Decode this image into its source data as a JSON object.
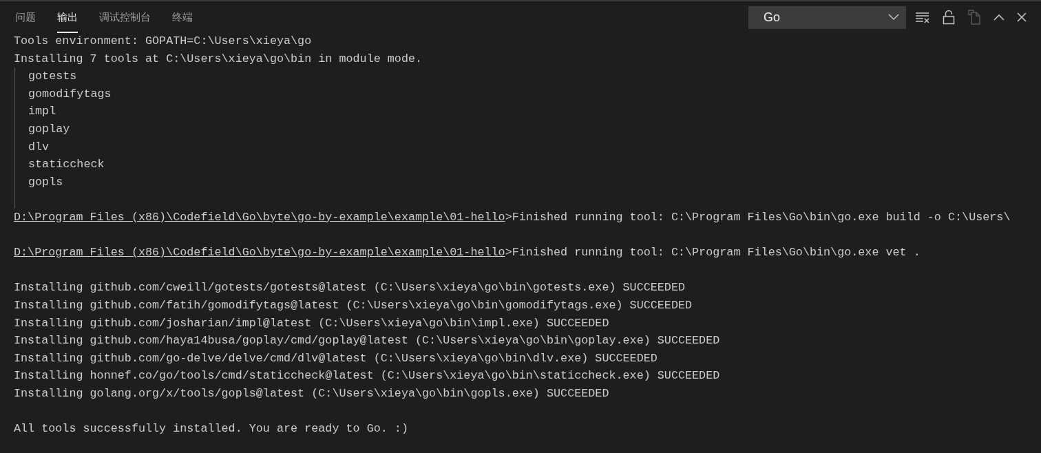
{
  "tabs": [
    {
      "label": "问题",
      "selected": false
    },
    {
      "label": "输出",
      "selected": true
    },
    {
      "label": "调试控制台",
      "selected": false
    },
    {
      "label": "终端",
      "selected": false
    }
  ],
  "channel_select": {
    "value": "Go"
  },
  "actions": [
    {
      "kind": "clear",
      "disabled": false
    },
    {
      "kind": "lock",
      "disabled": false
    },
    {
      "kind": "copy",
      "disabled": true
    },
    {
      "kind": "maximize",
      "disabled": false
    },
    {
      "kind": "close",
      "disabled": false
    }
  ],
  "output_lines": [
    {
      "kind": "text",
      "text": "Tools environment: GOPATH=C:\\Users\\xieya\\go"
    },
    {
      "kind": "text",
      "text": "Installing 7 tools at C:\\Users\\xieya\\go\\bin in module mode."
    },
    {
      "kind": "group",
      "items": [
        "gotests",
        "gomodifytags",
        "impl",
        "goplay",
        "dlv",
        "staticcheck",
        "gopls"
      ]
    },
    {
      "kind": "link",
      "link": "D:\\Program Files (x86)\\Codefield\\Go\\byte\\go-by-example\\example\\01-hello",
      "text": ">Finished running tool: C:\\Program Files\\Go\\bin\\go.exe build -o C:\\Users\\"
    },
    {
      "kind": "blank"
    },
    {
      "kind": "link",
      "link": "D:\\Program Files (x86)\\Codefield\\Go\\byte\\go-by-example\\example\\01-hello",
      "text": ">Finished running tool: C:\\Program Files\\Go\\bin\\go.exe vet ."
    },
    {
      "kind": "blank"
    },
    {
      "kind": "text",
      "text": "Installing github.com/cweill/gotests/gotests@latest (C:\\Users\\xieya\\go\\bin\\gotests.exe) SUCCEEDED"
    },
    {
      "kind": "text",
      "text": "Installing github.com/fatih/gomodifytags@latest (C:\\Users\\xieya\\go\\bin\\gomodifytags.exe) SUCCEEDED"
    },
    {
      "kind": "text",
      "text": "Installing github.com/josharian/impl@latest (C:\\Users\\xieya\\go\\bin\\impl.exe) SUCCEEDED"
    },
    {
      "kind": "text",
      "text": "Installing github.com/haya14busa/goplay/cmd/goplay@latest (C:\\Users\\xieya\\go\\bin\\goplay.exe) SUCCEEDED"
    },
    {
      "kind": "text",
      "text": "Installing github.com/go-delve/delve/cmd/dlv@latest (C:\\Users\\xieya\\go\\bin\\dlv.exe) SUCCEEDED"
    },
    {
      "kind": "text",
      "text": "Installing honnef.co/go/tools/cmd/staticcheck@latest (C:\\Users\\xieya\\go\\bin\\staticcheck.exe) SUCCEEDED"
    },
    {
      "kind": "text",
      "text": "Installing golang.org/x/tools/gopls@latest (C:\\Users\\xieya\\go\\bin\\gopls.exe) SUCCEEDED"
    },
    {
      "kind": "blank"
    },
    {
      "kind": "text",
      "text": "All tools successfully installed. You are ready to Go. :)"
    }
  ]
}
